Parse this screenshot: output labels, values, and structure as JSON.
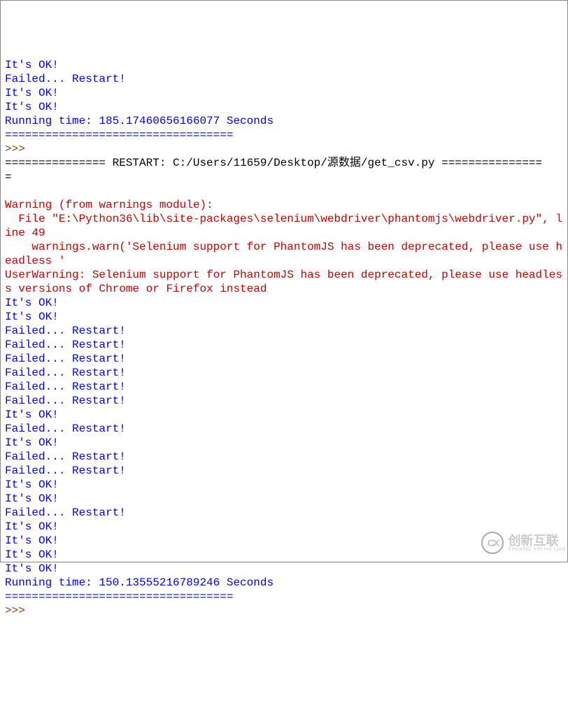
{
  "console": {
    "lines": [
      {
        "text": "It's OK!",
        "class": "blue"
      },
      {
        "text": "Failed... Restart!",
        "class": "blue"
      },
      {
        "text": "It's OK!",
        "class": "blue"
      },
      {
        "text": "It's OK!",
        "class": "blue"
      },
      {
        "text": "Running time: 185.17460656166077 Seconds",
        "class": "blue"
      },
      {
        "text": "==================================",
        "class": "blue"
      }
    ],
    "prompt1": ">>> ",
    "restart_line": "=============== RESTART: C:/Users/11659/Desktop/源数据/get_csv.py ===============",
    "restart_continuation": "=",
    "blank": "",
    "warning_lines": [
      {
        "text": "Warning (from warnings module):",
        "class": "red"
      },
      {
        "text": "  File \"E:\\Python36\\lib\\site-packages\\selenium\\webdriver\\phantomjs\\webdriver.py\", line 49",
        "class": "red"
      },
      {
        "text": "    warnings.warn('Selenium support for PhantomJS has been deprecated, please use headless '",
        "class": "red"
      },
      {
        "text": "UserWarning: Selenium support for PhantomJS has been deprecated, please use headless versions of Chrome or Firefox instead",
        "class": "red"
      }
    ],
    "output_lines": [
      {
        "text": "It's OK!",
        "class": "blue"
      },
      {
        "text": "It's OK!",
        "class": "blue"
      },
      {
        "text": "Failed... Restart!",
        "class": "blue"
      },
      {
        "text": "Failed... Restart!",
        "class": "blue"
      },
      {
        "text": "Failed... Restart!",
        "class": "blue"
      },
      {
        "text": "Failed... Restart!",
        "class": "blue"
      },
      {
        "text": "Failed... Restart!",
        "class": "blue"
      },
      {
        "text": "Failed... Restart!",
        "class": "blue"
      },
      {
        "text": "It's OK!",
        "class": "blue"
      },
      {
        "text": "Failed... Restart!",
        "class": "blue"
      },
      {
        "text": "It's OK!",
        "class": "blue"
      },
      {
        "text": "Failed... Restart!",
        "class": "blue"
      },
      {
        "text": "Failed... Restart!",
        "class": "blue"
      },
      {
        "text": "It's OK!",
        "class": "blue"
      },
      {
        "text": "It's OK!",
        "class": "blue"
      },
      {
        "text": "Failed... Restart!",
        "class": "blue"
      },
      {
        "text": "It's OK!",
        "class": "blue"
      },
      {
        "text": "It's OK!",
        "class": "blue"
      },
      {
        "text": "It's OK!",
        "class": "blue"
      },
      {
        "text": "It's OK!",
        "class": "blue"
      },
      {
        "text": "Running time: 150.13555216789246 Seconds",
        "class": "blue"
      },
      {
        "text": "==================================",
        "class": "blue"
      }
    ],
    "prompt2": ">>> "
  },
  "watermark": {
    "icon_text": "CX",
    "cn": "创新互联",
    "en": "CHUANG XIN HU LIAN"
  }
}
